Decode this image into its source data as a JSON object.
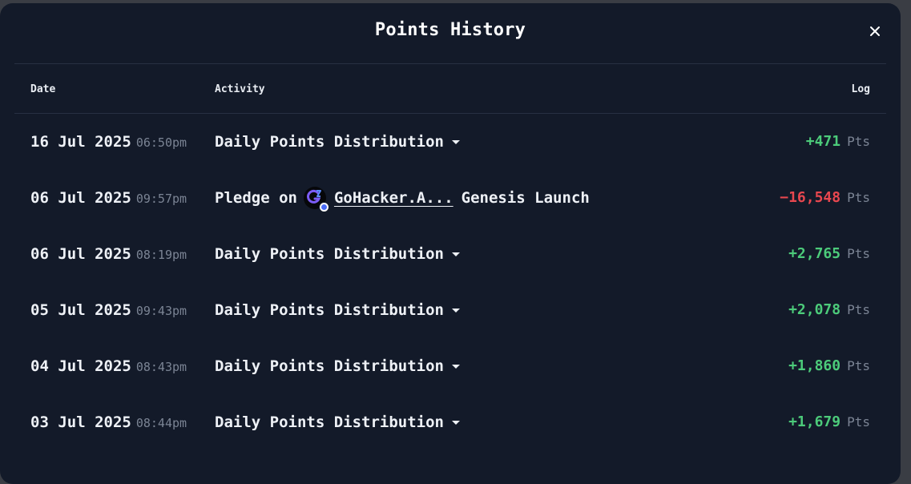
{
  "modal": {
    "title": "Points History",
    "close_icon": "close-icon"
  },
  "colors": {
    "background": "#131a29",
    "positive": "#4ccb7a",
    "negative": "#e8474f",
    "muted": "#7b8494"
  },
  "table": {
    "headers": {
      "date": "Date",
      "activity": "Activity",
      "log": "Log"
    },
    "rows": [
      {
        "date": "16 Jul 2025",
        "time": "06:50pm",
        "activity": "Daily Points Distribution",
        "log": "+471",
        "unit": "Pts",
        "sign": "positive"
      },
      {
        "date": "06 Jul 2025",
        "time": "09:57pm",
        "activity_prefix": "Pledge on",
        "project": "GoHacker.A...",
        "activity_suffix": "Genesis Launch",
        "project_icon": "gohacker-logo-icon",
        "log": "−16,548",
        "unit": "Pts",
        "sign": "negative"
      },
      {
        "date": "06 Jul 2025",
        "time": "08:19pm",
        "activity": "Daily Points Distribution",
        "log": "+2,765",
        "unit": "Pts",
        "sign": "positive"
      },
      {
        "date": "05 Jul 2025",
        "time": "09:43pm",
        "activity": "Daily Points Distribution",
        "log": "+2,078",
        "unit": "Pts",
        "sign": "positive"
      },
      {
        "date": "04 Jul 2025",
        "time": "08:43pm",
        "activity": "Daily Points Distribution",
        "log": "+1,860",
        "unit": "Pts",
        "sign": "positive"
      },
      {
        "date": "03 Jul 2025",
        "time": "08:44pm",
        "activity": "Daily Points Distribution",
        "log": "+1,679",
        "unit": "Pts",
        "sign": "positive"
      }
    ]
  }
}
